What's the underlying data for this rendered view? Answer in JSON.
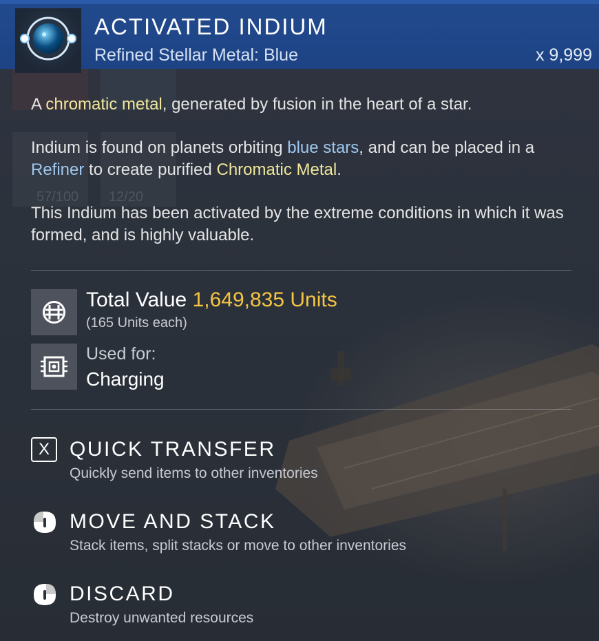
{
  "item": {
    "name": "ACTIVATED INDIUM",
    "subtitle": "Refined Stellar Metal: Blue",
    "quantity": "x 9,999",
    "icon": "activated-indium-orb-icon"
  },
  "description": {
    "line1": {
      "pre": "A ",
      "highlight": "chromatic metal",
      "post": ", generated by fusion in the heart of a star."
    },
    "line2": {
      "pre": "Indium is found on planets orbiting ",
      "highlight1": "blue stars",
      "mid1": ", and can be placed in a ",
      "highlight2": "Refiner",
      "mid2": " to create purified ",
      "highlight3": "Chromatic Metal",
      "post": "."
    },
    "line3": "This Indium has been activated by the extreme conditions in which it was formed, and is highly valuable."
  },
  "stats": {
    "total_label": "Total Value",
    "total_value": "1,649,835 Units",
    "each": "(165 Units each)",
    "used_label": "Used for:",
    "used_value": "Charging"
  },
  "actions": [
    {
      "key": "X",
      "title": "QUICK TRANSFER",
      "desc": "Quickly send items to other inventories"
    },
    {
      "title": "MOVE AND STACK",
      "desc": "Stack items, split stacks or move to other inventories"
    },
    {
      "title": "DISCARD",
      "desc": "Destroy unwanted resources"
    }
  ],
  "background": {
    "slot_counts": [
      "57/100",
      "12/20"
    ]
  },
  "colors": {
    "header": "#214a8d",
    "highlight_yellow": "#f1e79a",
    "highlight_blue": "#9fc7ef",
    "units_gold": "#f5c542"
  }
}
